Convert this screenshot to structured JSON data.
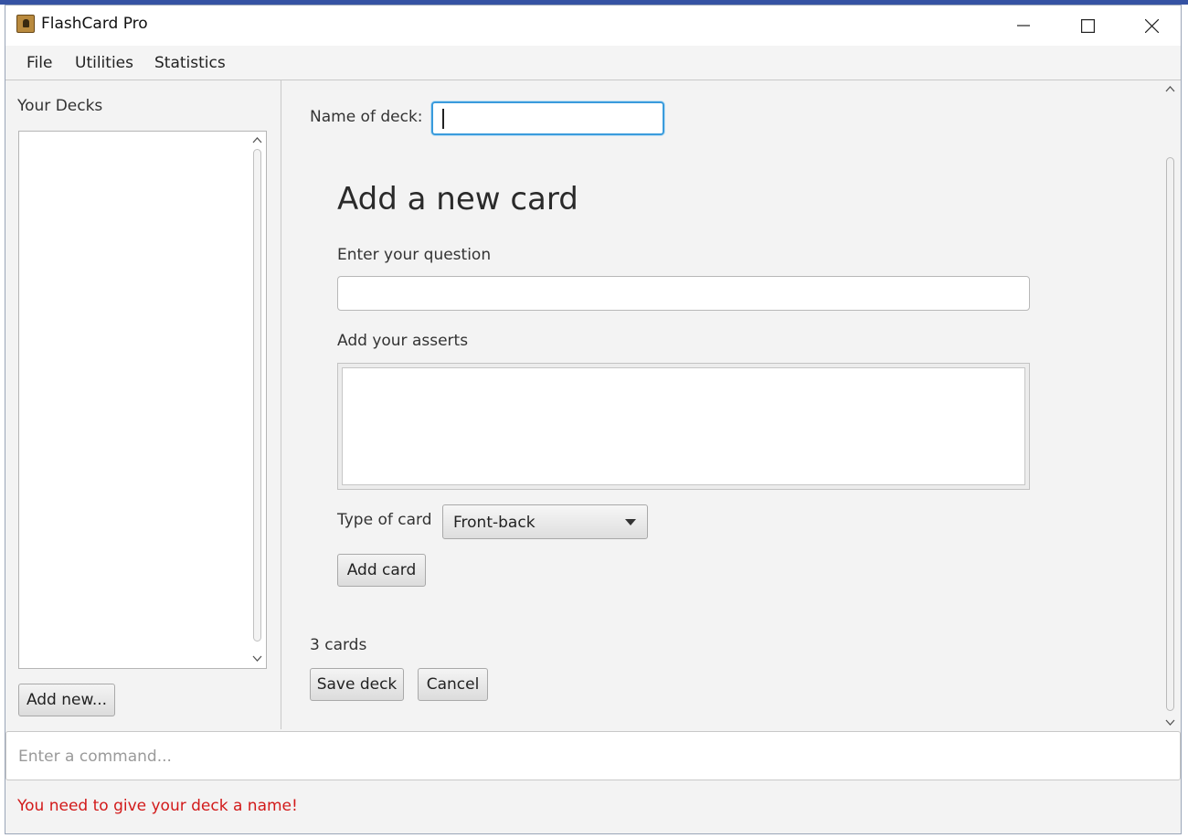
{
  "window": {
    "title": "FlashCard Pro"
  },
  "menu": {
    "items": [
      "File",
      "Utilities",
      "Statistics"
    ]
  },
  "sidebar": {
    "title": "Your Decks",
    "add_new_label": "Add new..."
  },
  "main": {
    "deck_name_label": "Name of deck:",
    "deck_name_value": "",
    "heading": "Add a new card",
    "question_label": "Enter your question",
    "question_value": "",
    "asserts_label": "Add your asserts",
    "card_type_label": "Type of card",
    "card_type_value": "Front-back",
    "add_card_label": "Add card",
    "card_count": "3 cards",
    "save_label": "Save deck",
    "cancel_label": "Cancel"
  },
  "command": {
    "placeholder": "Enter a command..."
  },
  "status": {
    "error": "You need to give your deck a name!",
    "error_color": "#d21a1a"
  }
}
